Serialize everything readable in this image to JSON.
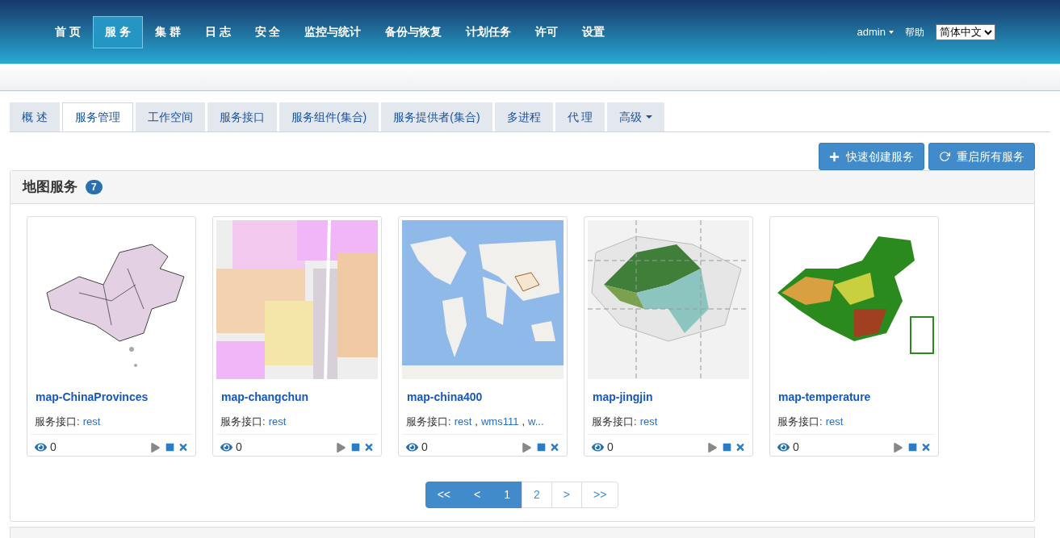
{
  "nav": {
    "items": [
      {
        "label": "首 页",
        "selected": false
      },
      {
        "label": "服 务",
        "selected": true
      },
      {
        "label": "集 群",
        "selected": false
      },
      {
        "label": "日 志",
        "selected": false
      },
      {
        "label": "安 全",
        "selected": false
      },
      {
        "label": "监控与统计",
        "selected": false
      },
      {
        "label": "备份与恢复",
        "selected": false
      },
      {
        "label": "计划任务",
        "selected": false
      },
      {
        "label": "许可",
        "selected": false
      },
      {
        "label": "设置",
        "selected": false
      }
    ],
    "user": "admin",
    "help": "帮助",
    "language": "简体中文"
  },
  "tabs": [
    {
      "label": "概 述",
      "selected": false,
      "dropdown": false
    },
    {
      "label": "服务管理",
      "selected": true,
      "dropdown": false
    },
    {
      "label": "工作空间",
      "selected": false,
      "dropdown": false
    },
    {
      "label": "服务接口",
      "selected": false,
      "dropdown": false
    },
    {
      "label": "服务组件(集合)",
      "selected": false,
      "dropdown": false
    },
    {
      "label": "服务提供者(集合)",
      "selected": false,
      "dropdown": false
    },
    {
      "label": "多进程",
      "selected": false,
      "dropdown": false
    },
    {
      "label": "代 理",
      "selected": false,
      "dropdown": false
    },
    {
      "label": "高级",
      "selected": false,
      "dropdown": true
    }
  ],
  "actions": [
    {
      "kind": "add",
      "label": "快速创建服务"
    },
    {
      "kind": "restart",
      "label": "重启所有服务"
    }
  ],
  "map_panel": {
    "title": "地图服务",
    "count": "7",
    "cards": [
      {
        "name": "map-ChinaProvinces",
        "interface_label": "服务接口:",
        "interfaces": [
          {
            "label": "rest"
          }
        ],
        "views": "0"
      },
      {
        "name": "map-changchun",
        "interface_label": "服务接口:",
        "interfaces": [
          {
            "label": "rest"
          }
        ],
        "views": "0"
      },
      {
        "name": "map-china400",
        "interface_label": "服务接口:",
        "interfaces": [
          {
            "label": "rest"
          },
          {
            "separator": ",",
            "label": "wms111"
          },
          {
            "separator": ",",
            "label": "w..."
          }
        ],
        "views": "0"
      },
      {
        "name": "map-jingjin",
        "interface_label": "服务接口:",
        "interfaces": [
          {
            "label": "rest"
          }
        ],
        "views": "0"
      },
      {
        "name": "map-temperature",
        "interface_label": "服务接口:",
        "interfaces": [
          {
            "label": "rest"
          }
        ],
        "views": "0"
      }
    ],
    "pagination": [
      {
        "label": "<<",
        "selected": true
      },
      {
        "label": "<",
        "selected": true
      },
      {
        "label": "1",
        "selected": true
      },
      {
        "label": "2",
        "selected": false
      },
      {
        "label": ">",
        "selected": false
      },
      {
        "label": ">>",
        "selected": false
      }
    ]
  }
}
